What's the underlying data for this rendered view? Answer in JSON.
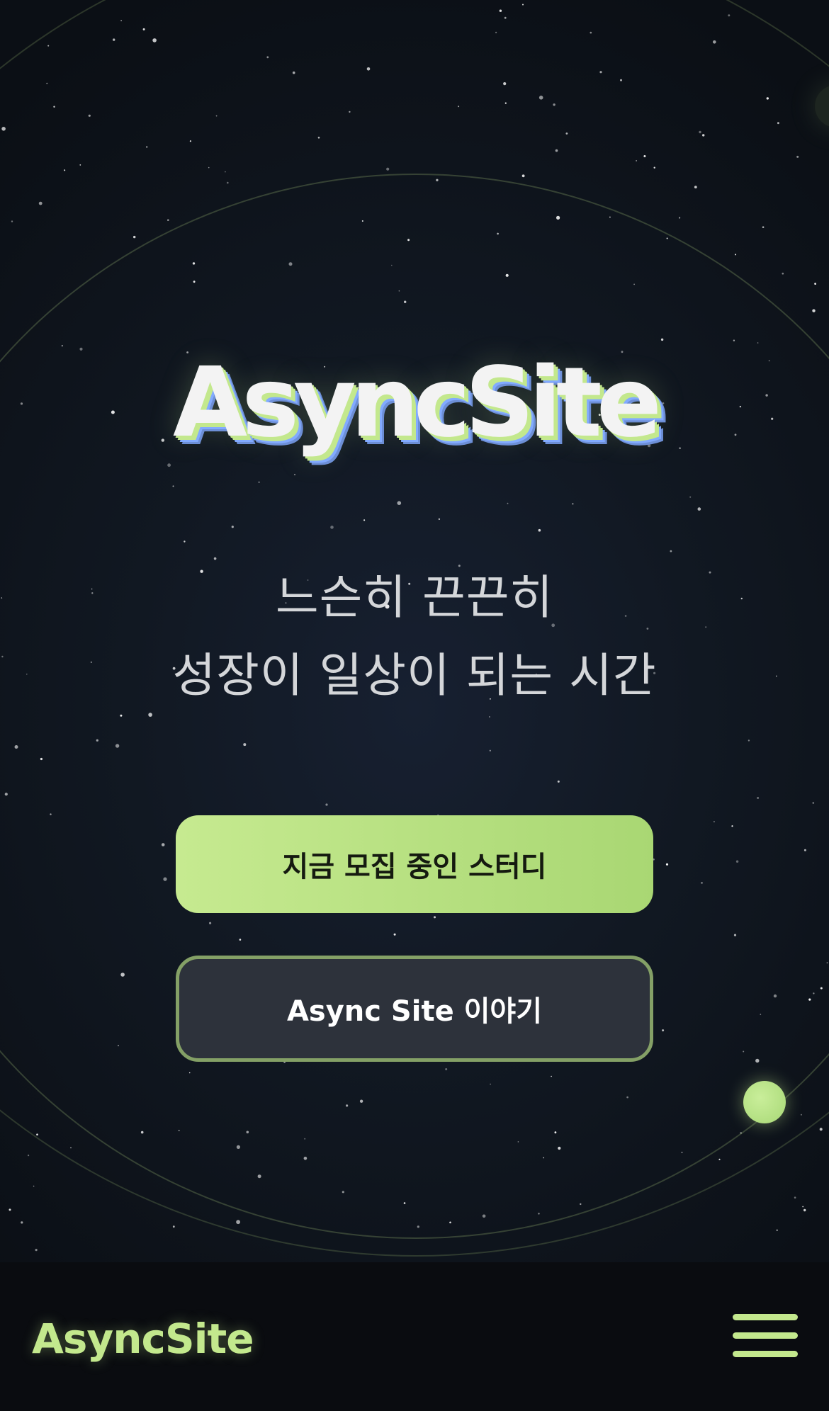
{
  "hero": {
    "logo_text": "AsyncSite",
    "tagline_line1": "느슨히 끈끈히",
    "tagline_line2": "성장이 일상이 되는 시간",
    "primary_button_label": "지금 모집 중인 스터디",
    "secondary_button_label": "Async Site 이야기"
  },
  "footer": {
    "logo_text": "AsyncSite",
    "menu_icon": "hamburger-menu-icon"
  },
  "colors": {
    "accent": "#c3e88d",
    "accent_blue": "#82aaff",
    "background": "#0a0d12",
    "text": "#d4d6d9"
  }
}
